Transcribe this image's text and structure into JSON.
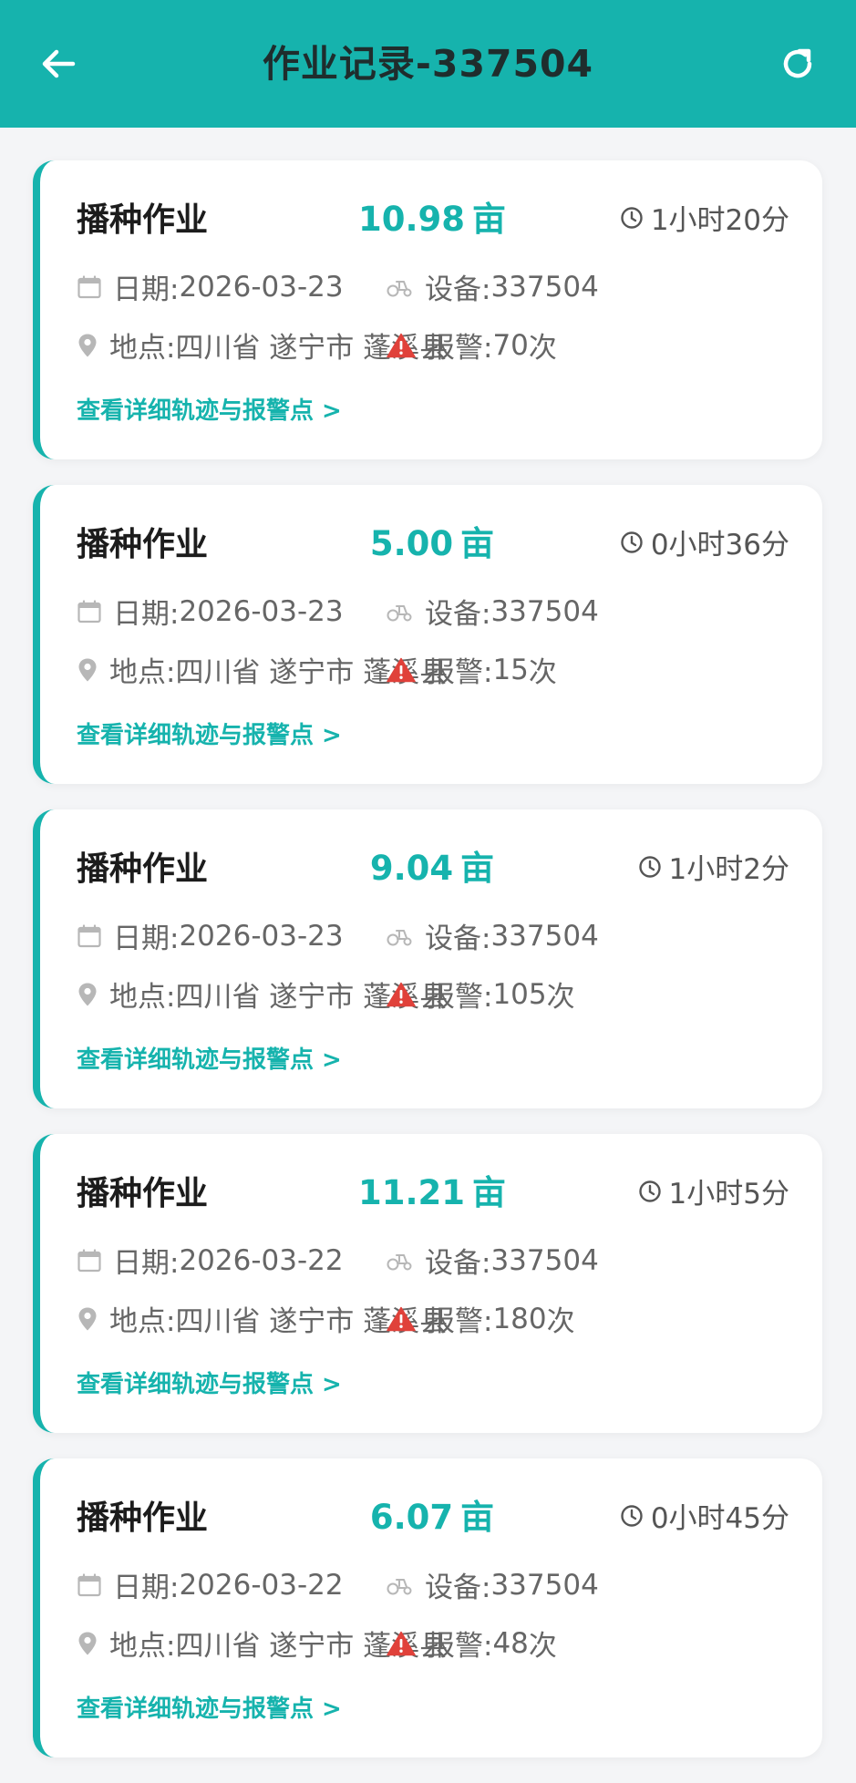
{
  "header": {
    "title": "作业记录-337504",
    "bg_color": "#16b3ad"
  },
  "labels": {
    "date": "日期: ",
    "device": "设备: ",
    "location": "地点: ",
    "alarm": "报警: ",
    "alarm_unit": " 次",
    "area_unit": "亩",
    "detail_link": "查看详细轨迹与报警点 >"
  },
  "icons": {
    "back": "arrow-left-icon",
    "refresh": "refresh-icon",
    "duration": "clock-icon",
    "date": "calendar-icon",
    "device": "tractor-icon",
    "location": "map-pin-icon",
    "alarm": "warning-icon"
  },
  "records": [
    {
      "type": "播种作业",
      "area": "10.98",
      "duration": "1小时20分",
      "date": "2026-03-23",
      "device": "337504",
      "location": "四川省 遂宁市 蓬溪县",
      "alarms": "70"
    },
    {
      "type": "播种作业",
      "area": "5.00",
      "duration": "0小时36分",
      "date": "2026-03-23",
      "device": "337504",
      "location": "四川省 遂宁市 蓬溪县",
      "alarms": "15"
    },
    {
      "type": "播种作业",
      "area": "9.04",
      "duration": "1小时2分",
      "date": "2026-03-23",
      "device": "337504",
      "location": "四川省 遂宁市 蓬溪县",
      "alarms": "105"
    },
    {
      "type": "播种作业",
      "area": "11.21",
      "duration": "1小时5分",
      "date": "2026-03-22",
      "device": "337504",
      "location": "四川省 遂宁市 蓬溪县",
      "alarms": "180"
    },
    {
      "type": "播种作业",
      "area": "6.07",
      "duration": "0小时45分",
      "date": "2026-03-22",
      "device": "337504",
      "location": "四川省 遂宁市 蓬溪县",
      "alarms": "48"
    }
  ],
  "colors": {
    "accent": "#16b3ad",
    "alarm": "#e0413a",
    "muted_icon": "#b7b7b7"
  }
}
